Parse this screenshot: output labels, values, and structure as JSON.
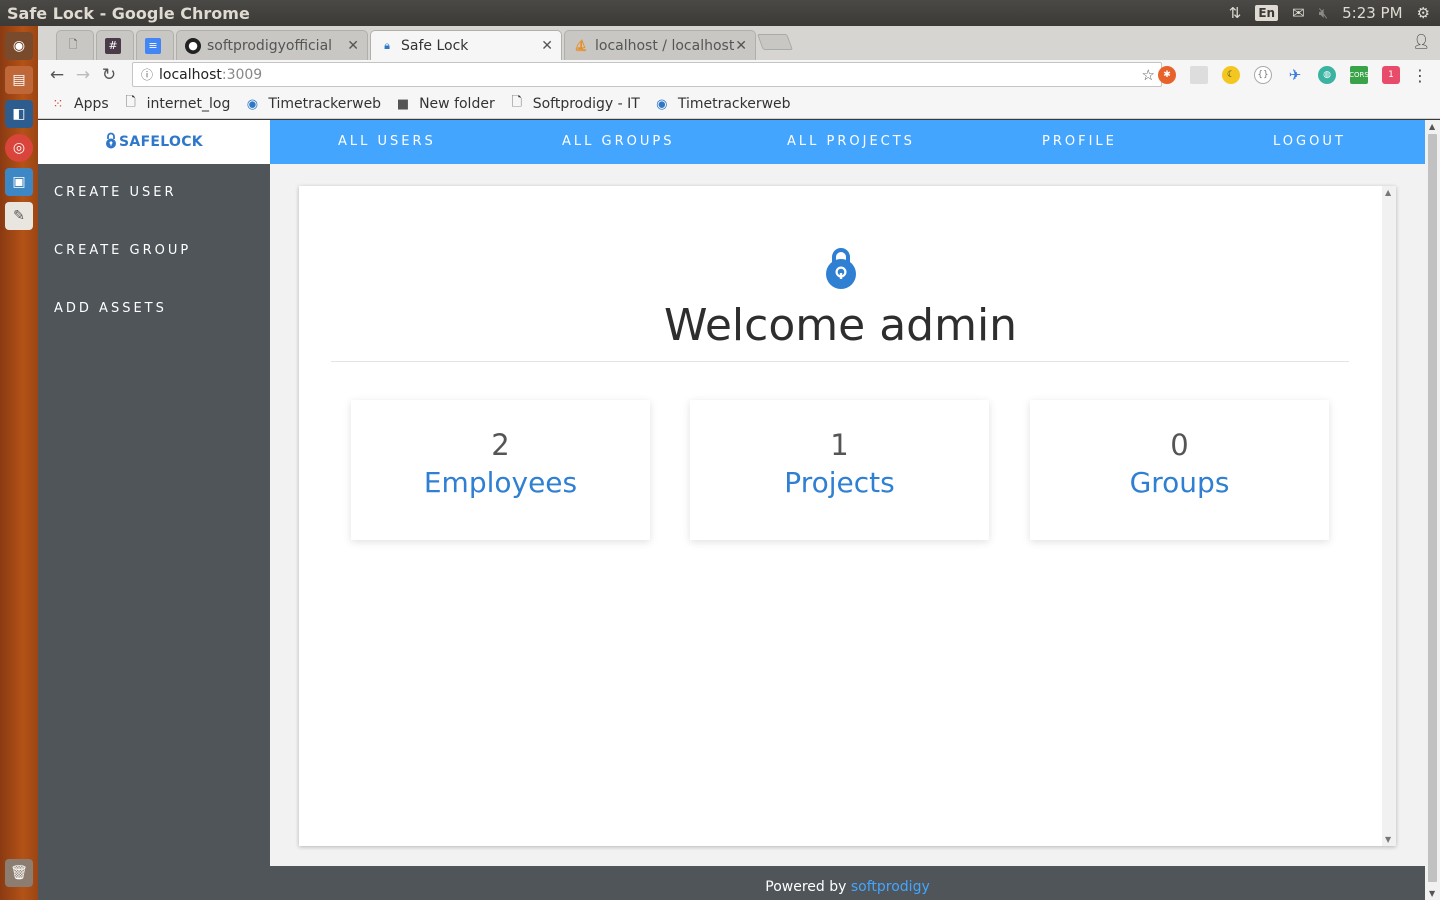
{
  "window": {
    "title": "Safe Lock - Google Chrome",
    "time": "5:23 PM",
    "keyboard": "En"
  },
  "tabs": [
    {
      "label": "",
      "icon": "document-icon"
    },
    {
      "label": "",
      "icon": "slack-icon"
    },
    {
      "label": "",
      "icon": "docs-icon"
    },
    {
      "label": "softprodigyofficial",
      "icon": "github-icon"
    },
    {
      "label": "Safe Lock",
      "icon": "lock-icon"
    },
    {
      "label": "localhost / localhost",
      "icon": "phpmyadmin-icon"
    }
  ],
  "address": {
    "host": "localhost",
    "port": ":3009"
  },
  "bookmarks": [
    {
      "label": "Apps"
    },
    {
      "label": "internet_log"
    },
    {
      "label": "Timetrackerweb"
    },
    {
      "label": "New folder"
    },
    {
      "label": "Softprodigy - IT"
    },
    {
      "label": "Timetrackerweb"
    }
  ],
  "app": {
    "brand": "SAFELOCK",
    "sidebar": [
      "CREATE USER",
      "CREATE GROUP",
      "ADD ASSETS"
    ],
    "nav": [
      "ALL USERS",
      "ALL GROUPS",
      "ALL PROJECTS",
      "PROFILE",
      "LOGOUT"
    ],
    "welcome": "Welcome admin",
    "cards": [
      {
        "count": "2",
        "label": "Employees"
      },
      {
        "count": "1",
        "label": "Projects"
      },
      {
        "count": "0",
        "label": "Groups"
      }
    ],
    "footer": {
      "text": "Powered by",
      "link": "softprodigy"
    }
  },
  "colors": {
    "nav": "#44a5fe",
    "sidebar": "#4f5559",
    "accent": "#2f7fd2"
  }
}
